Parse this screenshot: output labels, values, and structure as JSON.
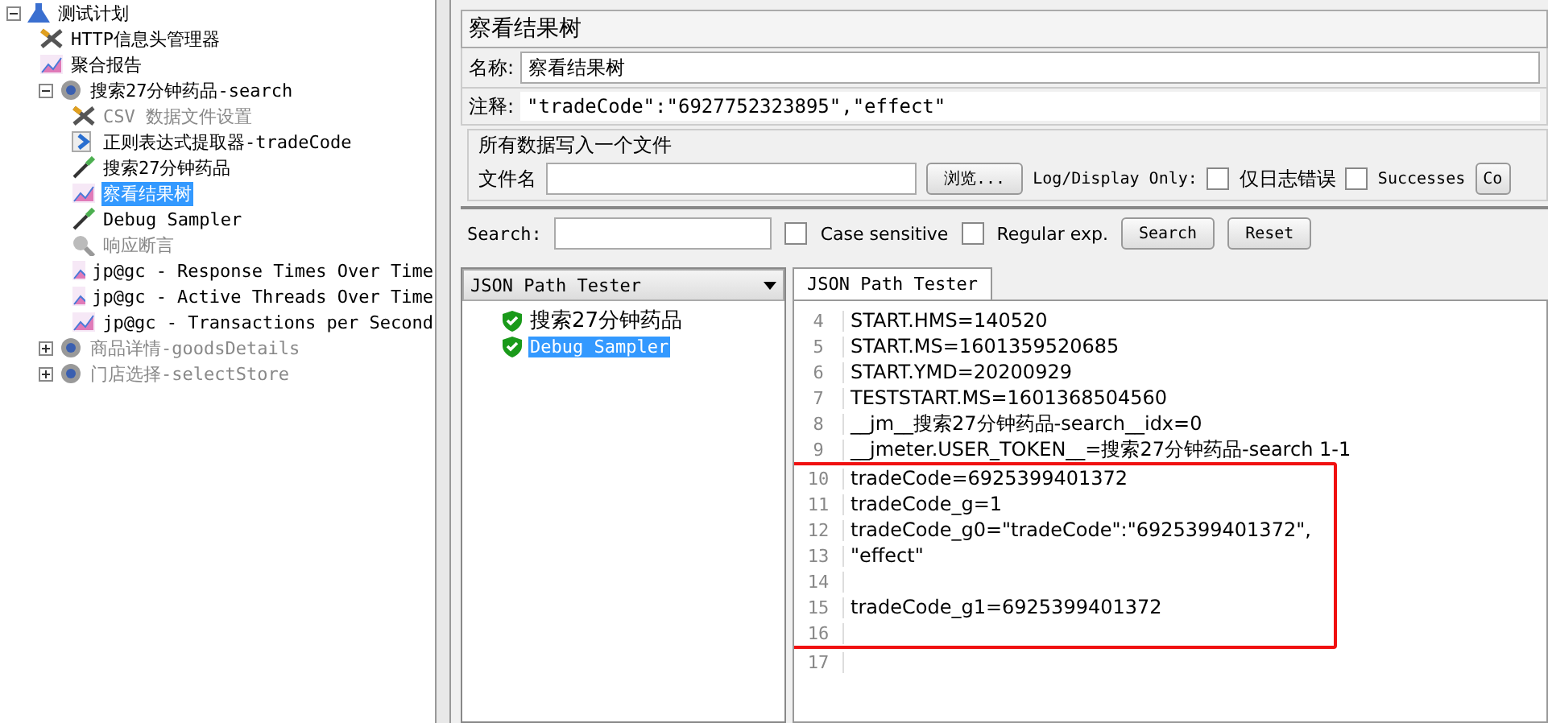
{
  "tree": {
    "label": "测试计划",
    "kind": "flask",
    "expanded": true,
    "children": [
      {
        "label": "HTTP信息头管理器",
        "kind": "tools",
        "disabled": false,
        "selected": false
      },
      {
        "label": "聚合报告",
        "kind": "chart",
        "disabled": false,
        "selected": false
      },
      {
        "label": "搜索27分钟药品-search",
        "kind": "gear",
        "disabled": false,
        "selected": false,
        "expanded": true,
        "children": [
          {
            "label": "CSV 数据文件设置",
            "kind": "tools",
            "disabled": true,
            "selected": false
          },
          {
            "label": "正则表达式提取器-tradeCode",
            "kind": "arrow",
            "disabled": false,
            "selected": false
          },
          {
            "label": "搜索27分钟药品",
            "kind": "pipette",
            "disabled": false,
            "selected": false
          },
          {
            "label": "察看结果树",
            "kind": "chart",
            "disabled": false,
            "selected": true
          },
          {
            "label": "Debug Sampler",
            "kind": "pipette",
            "disabled": false,
            "selected": false
          },
          {
            "label": "响应断言",
            "kind": "magnifier",
            "disabled": true,
            "selected": false
          },
          {
            "label": "jp@gc - Response Times Over Time",
            "kind": "chart",
            "disabled": false,
            "selected": false
          },
          {
            "label": "jp@gc - Active Threads Over Time",
            "kind": "chart",
            "disabled": false,
            "selected": false
          },
          {
            "label": "jp@gc - Transactions per Second",
            "kind": "chart",
            "disabled": false,
            "selected": false
          }
        ]
      },
      {
        "label": "商品详情-goodsDetails",
        "kind": "gear",
        "disabled": true,
        "selected": false,
        "expanded": false
      },
      {
        "label": "门店选择-selectStore",
        "kind": "gear",
        "disabled": true,
        "selected": false,
        "expanded": false
      }
    ]
  },
  "panel": {
    "title": "察看结果树",
    "name": {
      "label": "名称:",
      "value": "察看结果树"
    },
    "comment": {
      "label": "注释:",
      "value": "\"tradeCode\":\"6927752323895\",\"effect\""
    },
    "file_group": {
      "title": "所有数据写入一个文件",
      "file_label": "文件名",
      "browse": "浏览...",
      "log_label": "Log/Display Only:",
      "checks": [
        {
          "label": "仅日志错误",
          "checked": false
        },
        {
          "label": "Successes",
          "checked": false
        }
      ],
      "cut_button": "Co"
    }
  },
  "search": {
    "label": "Search:",
    "options": [
      {
        "label": "Case sensitive",
        "checked": false
      },
      {
        "label": "Regular exp.",
        "checked": false
      }
    ],
    "buttons": [
      "Search",
      "Reset"
    ]
  },
  "results": {
    "renderer": "JSON Path Tester",
    "samples": [
      {
        "label": "搜索27分钟药品",
        "selected": false
      },
      {
        "label": "Debug Sampler",
        "selected": true
      }
    ]
  },
  "viewer": {
    "tabs": [
      {
        "label": "JSON Path Tester",
        "selected": true
      }
    ],
    "lines": [
      {
        "kind": "line",
        "no": "4",
        "text": "START.HMS=140520"
      },
      {
        "kind": "line",
        "no": "5",
        "text": "START.MS=1601359520685"
      },
      {
        "kind": "line",
        "no": "6",
        "text": "START.YMD=20200929"
      },
      {
        "kind": "line",
        "no": "7",
        "text": "TESTSTART.MS=1601368504560"
      },
      {
        "kind": "line",
        "no": "8",
        "text": "__jm__搜索27分钟药品-search__idx=0"
      },
      {
        "kind": "line",
        "no": "9",
        "text": "__jmeter.USER_TOKEN__=搜索27分钟药品-search 1-1"
      },
      {
        "kind": "highlight_box",
        "lines": [
          {
            "no": "10",
            "text": "tradeCode=6925399401372"
          },
          {
            "no": "11",
            "text": "tradeCode_g=1"
          },
          {
            "no": "12",
            "text": "tradeCode_g0=\"tradeCode\":\"6925399401372\","
          },
          {
            "no": "13",
            "text": "\"effect\""
          },
          {
            "no": "14"
          },
          {
            "no": "15",
            "text": "tradeCode_g1=6925399401372"
          },
          {
            "no": "16"
          }
        ]
      },
      {
        "kind": "line",
        "no": "17"
      }
    ]
  }
}
